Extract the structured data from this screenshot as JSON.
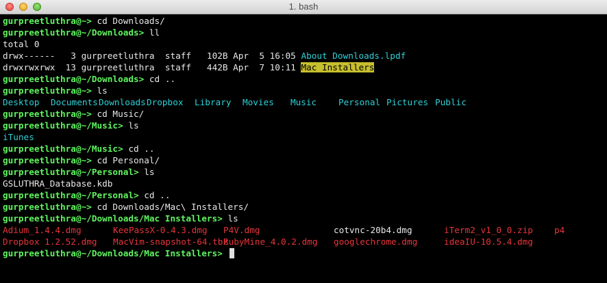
{
  "window": {
    "title": "1. bash"
  },
  "prompt": {
    "user": "gurpreetluthra",
    "at": "@"
  },
  "lines": [
    {
      "path": "~",
      "cmd": "cd Downloads/"
    },
    {
      "path": "~/Downloads",
      "cmd": "ll"
    },
    {
      "out": "total 0"
    },
    {
      "ls_perm": "drwx------",
      "ls_links": "3",
      "ls_user": "gurpreetluthra",
      "ls_group": "staff",
      "ls_size": "102B",
      "ls_date": "Apr  5 16:05",
      "ls_name": "About Downloads.lpdf"
    },
    {
      "ls_perm": "drwxrwxrwx",
      "ls_links": "13",
      "ls_user": "gurpreetluthra",
      "ls_group": "staff",
      "ls_size": "442B",
      "ls_date": "Apr  7 10:11",
      "ls_name": "Mac Installers"
    },
    {
      "path": "~/Downloads",
      "cmd": "cd .."
    },
    {
      "path": "~",
      "cmd": "ls"
    },
    {
      "dirs": [
        "Desktop",
        "Documents",
        "Downloads",
        "Dropbox",
        "Library",
        "Movies",
        "Music",
        "Personal",
        "Pictures",
        "Public"
      ]
    },
    {
      "path": "~",
      "cmd": "cd Music/"
    },
    {
      "path": "~/Music",
      "cmd": "ls"
    },
    {
      "out": "iTunes"
    },
    {
      "path": "~/Music",
      "cmd": "cd .."
    },
    {
      "path": "~",
      "cmd": "cd Personal/"
    },
    {
      "path": "~/Personal",
      "cmd": "ls"
    },
    {
      "out": "GSLUTHRA_Database.kdb"
    },
    {
      "path": "~/Personal",
      "cmd": "cd .."
    },
    {
      "path": "~",
      "cmd": "cd Downloads/Mac\\ Installers/"
    },
    {
      "path": "~/Downloads/Mac Installers",
      "cmd": "ls"
    },
    {
      "files": [
        "Adium_1.4.4.dmg",
        "KeePassX-0.4.3.dmg",
        "P4V.dmg",
        "cotvnc-20b4.dmg",
        "iTerm2_v1_0_0.zip",
        "p4"
      ]
    },
    {
      "files": [
        "Dropbox 1.2.52.dmg",
        "MacVim-snapshot-64.tbz",
        "RubyMine_4.0.2.dmg",
        "googlechrome.dmg",
        "ideaIU-10.5.4.dmg"
      ]
    },
    {
      "path": "~/Downloads/Mac Installers",
      "cmd": ""
    }
  ],
  "colors": {
    "prompt": "#5ff55f",
    "directory": "#2fd0d6",
    "highlighted_dir_bg": "#c7be2e",
    "package_files": "#e8343a",
    "plain_text": "#e8e8e8"
  }
}
